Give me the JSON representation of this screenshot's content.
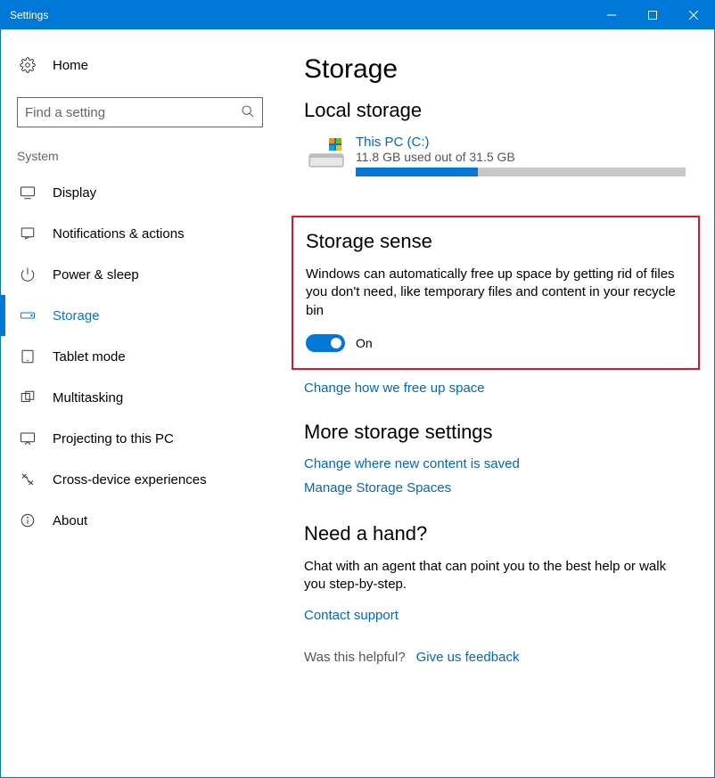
{
  "window": {
    "title": "Settings"
  },
  "sidebar": {
    "home": "Home",
    "search_placeholder": "Find a setting",
    "group": "System",
    "items": [
      {
        "label": "Display"
      },
      {
        "label": "Notifications & actions"
      },
      {
        "label": "Power & sleep"
      },
      {
        "label": "Storage"
      },
      {
        "label": "Tablet mode"
      },
      {
        "label": "Multitasking"
      },
      {
        "label": "Projecting to this PC"
      },
      {
        "label": "Cross-device experiences"
      },
      {
        "label": "About"
      }
    ]
  },
  "main": {
    "title": "Storage",
    "local_heading": "Local storage",
    "drive": {
      "name": "This PC (C:)",
      "usage": "11.8 GB used out of 31.5 GB",
      "fill_percent": 37
    },
    "sense": {
      "heading": "Storage sense",
      "desc": "Windows can automatically free up space by getting rid of files you don't need, like temporary files and content in your recycle bin",
      "toggle_label": "On",
      "change_link": "Change how we free up space"
    },
    "more": {
      "heading": "More storage settings",
      "link1": "Change where new content is saved",
      "link2": "Manage Storage Spaces"
    },
    "help": {
      "heading": "Need a hand?",
      "desc": "Chat with an agent that can point you to the best help or walk you step-by-step.",
      "link": "Contact support"
    },
    "feedback": {
      "prompt": "Was this helpful?",
      "link": "Give us feedback"
    }
  }
}
